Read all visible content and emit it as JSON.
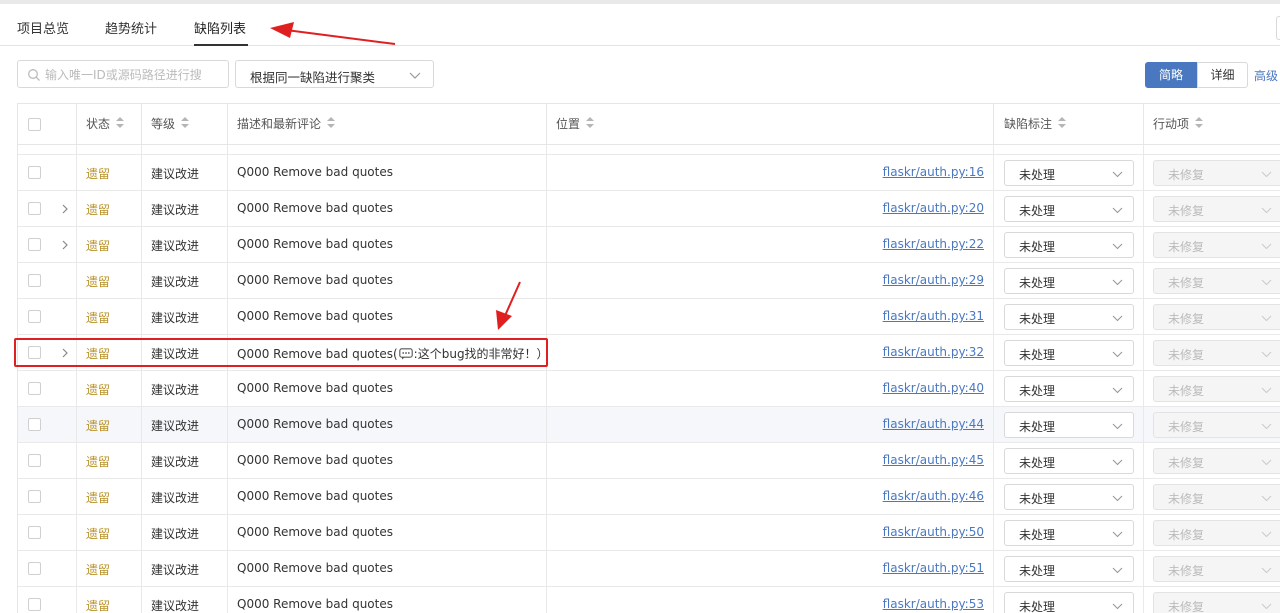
{
  "tabs": [
    {
      "label": "项目总览"
    },
    {
      "label": "趋势统计"
    },
    {
      "label": "缺陷列表"
    }
  ],
  "toolbar": {
    "search_placeholder": "输入唯一ID或源码路径进行搜",
    "cluster_value": "根据同一缺陷进行聚类",
    "view_simple": "简略",
    "view_detail": "详细",
    "advanced": "高级"
  },
  "table": {
    "headers": {
      "status": "状态",
      "level": "等级",
      "desc": "描述和最新评论",
      "location": "位置",
      "mark": "缺陷标注",
      "action": "行动项"
    },
    "rows": [
      {
        "status": "遗留",
        "level": "建议改进",
        "desc": "Q000 Remove bad quotes",
        "location": "flaskr/auth.py:16",
        "mark": "未处理",
        "action": "未修复"
      },
      {
        "status": "遗留",
        "level": "建议改进",
        "desc": "Q000 Remove bad quotes",
        "location": "flaskr/auth.py:20",
        "mark": "未处理",
        "action": "未修复"
      },
      {
        "status": "遗留",
        "level": "建议改进",
        "desc": "Q000 Remove bad quotes",
        "location": "flaskr/auth.py:22",
        "mark": "未处理",
        "action": "未修复"
      },
      {
        "status": "遗留",
        "level": "建议改进",
        "desc": "Q000 Remove bad quotes",
        "location": "flaskr/auth.py:29",
        "mark": "未处理",
        "action": "未修复"
      },
      {
        "status": "遗留",
        "level": "建议改进",
        "desc": "Q000 Remove bad quotes",
        "location": "flaskr/auth.py:31",
        "mark": "未处理",
        "action": "未修复"
      },
      {
        "status": "遗留",
        "level": "建议改进",
        "desc": "Q000 Remove bad quotes(",
        "comment": ":这个bug找的非常好！）",
        "location": "flaskr/auth.py:32",
        "mark": "未处理",
        "action": "未修复"
      },
      {
        "status": "遗留",
        "level": "建议改进",
        "desc": "Q000 Remove bad quotes",
        "location": "flaskr/auth.py:40",
        "mark": "未处理",
        "action": "未修复"
      },
      {
        "status": "遗留",
        "level": "建议改进",
        "desc": "Q000 Remove bad quotes",
        "location": "flaskr/auth.py:44",
        "mark": "未处理",
        "action": "未修复"
      },
      {
        "status": "遗留",
        "level": "建议改进",
        "desc": "Q000 Remove bad quotes",
        "location": "flaskr/auth.py:45",
        "mark": "未处理",
        "action": "未修复"
      },
      {
        "status": "遗留",
        "level": "建议改进",
        "desc": "Q000 Remove bad quotes",
        "location": "flaskr/auth.py:46",
        "mark": "未处理",
        "action": "未修复"
      },
      {
        "status": "遗留",
        "level": "建议改进",
        "desc": "Q000 Remove bad quotes",
        "location": "flaskr/auth.py:50",
        "mark": "未处理",
        "action": "未修复"
      },
      {
        "status": "遗留",
        "level": "建议改进",
        "desc": "Q000 Remove bad quotes",
        "location": "flaskr/auth.py:51",
        "mark": "未处理",
        "action": "未修复"
      },
      {
        "status": "遗留",
        "level": "建议改进",
        "desc": "Q000 Remove bad quotes",
        "location": "flaskr/auth.py:53",
        "mark": "未处理",
        "action": "未修复"
      }
    ]
  },
  "colors": {
    "accent": "#4a78c0",
    "status_text": "#b8932c",
    "annotation": "#e02020"
  }
}
